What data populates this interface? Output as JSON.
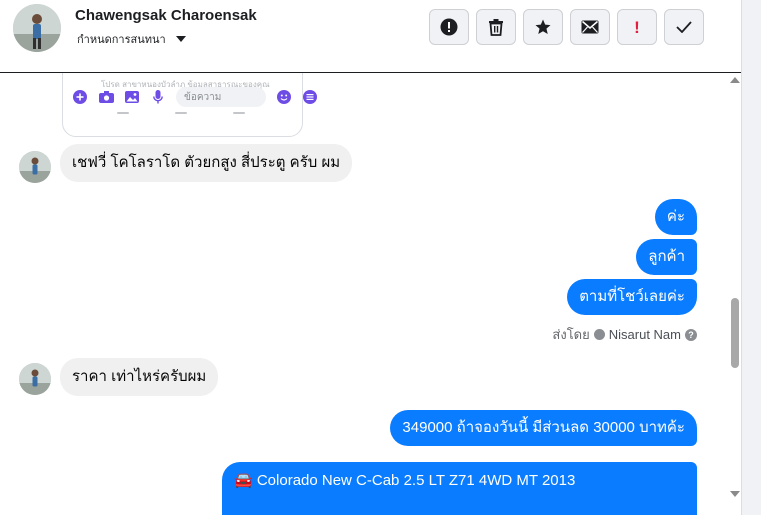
{
  "header": {
    "contact_name": "Chawengsak Charoensak",
    "assign_label": "กำหนดการสนทนา",
    "actions": [
      {
        "name": "report-icon",
        "label": "Report"
      },
      {
        "name": "trash-icon",
        "label": "Delete"
      },
      {
        "name": "star-icon",
        "label": "Star"
      },
      {
        "name": "envelope-icon",
        "label": "Mark unread"
      },
      {
        "name": "exclamation-icon",
        "label": "Spam"
      },
      {
        "name": "checkmark-icon",
        "label": "Done"
      }
    ]
  },
  "shared_image": {
    "hint_text": "โปรด สาขาหนองบัวลำภู ข้อมูลสาธารณะของคุณ",
    "input_placeholder": "ข้อความ",
    "icons": [
      "plus-circle-icon",
      "camera-icon",
      "image-icon",
      "microphone-icon",
      "emoji-icon",
      "menu-icon"
    ]
  },
  "messages": [
    {
      "direction": "incoming",
      "text": "เชฟวี่ โคโลราโด ตัวยกสูง สี่ประตู ครับ ผม"
    },
    {
      "direction": "outgoing",
      "text": "ค่ะ"
    },
    {
      "direction": "outgoing",
      "text": "ลูกค้า"
    },
    {
      "direction": "outgoing",
      "text": "ตามที่โชว์เลยค่ะ"
    },
    {
      "direction": "incoming",
      "text": "ราคา เท่าไหร่ครับผม"
    },
    {
      "direction": "outgoing",
      "text": "349000 ถ้าจองวันนี้ มีส่วนลด 30000 บาทค้ะ"
    },
    {
      "direction": "outgoing",
      "text": "🚘 Colorado New C-Cab 2.5 LT Z71 4WD MT 2013"
    }
  ],
  "sent_by": {
    "prefix": "ส่งโดย",
    "name": "Nisarut Nam",
    "help_glyph": "?"
  },
  "colors": {
    "outgoing_bubble": "#0a7cff",
    "incoming_bubble": "#f0f0f0",
    "spam_red": "#e41e3f"
  }
}
